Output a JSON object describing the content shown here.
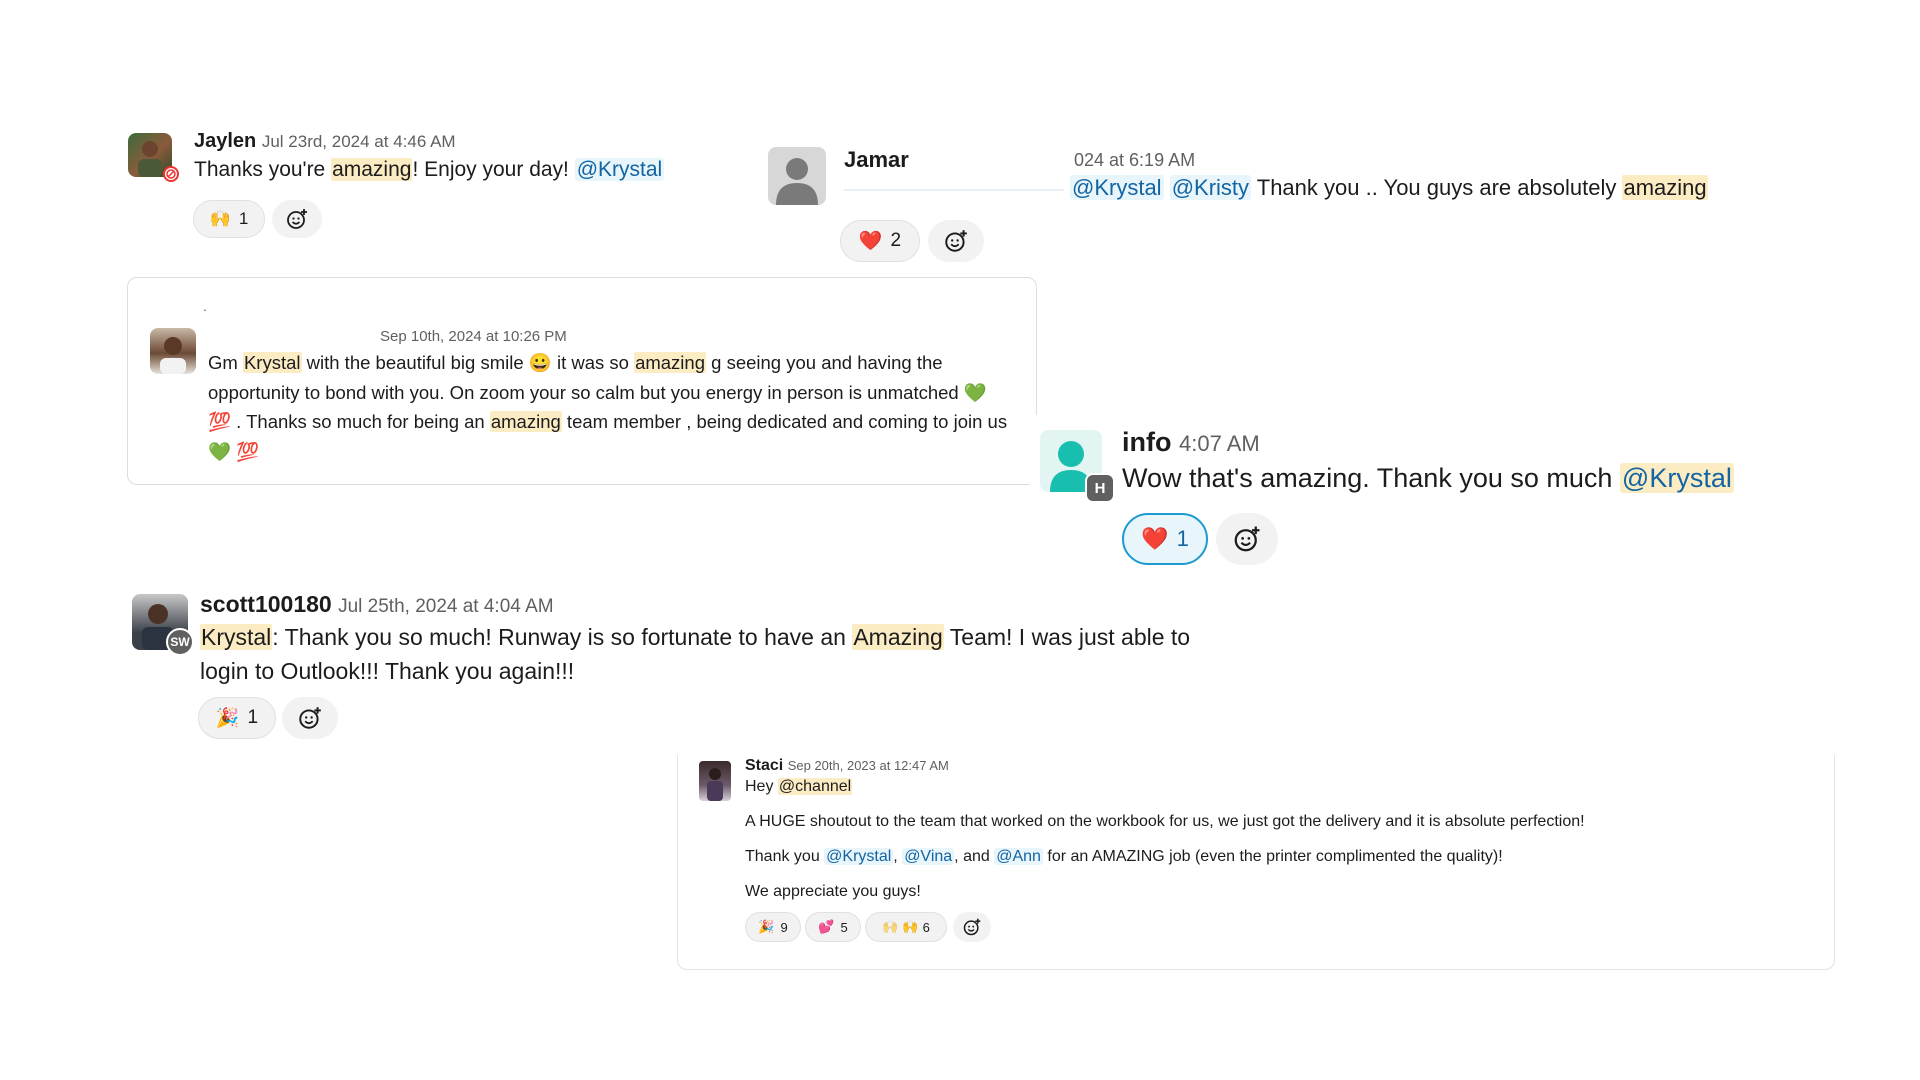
{
  "jaylen": {
    "name": "Jaylen",
    "time": "Jul 23rd, 2024 at 4:46 AM",
    "text_a": "Thanks you're ",
    "hl": "amazing",
    "text_b": "! Enjoy your day! ",
    "mention": "@Krystal",
    "reaction_count": "1"
  },
  "jamar": {
    "name": "Jamar",
    "time": "024 at 6:19 AM",
    "mention1": "@Krystal",
    "mention2": "@Kristy",
    "text": " Thank you .. You guys are absolutely ",
    "hl": "amazing",
    "reaction_count": "2"
  },
  "quote": {
    "dot": ".",
    "time": "Sep 10th, 2024 at 10:26 PM",
    "t1": "Gm ",
    "hl1": "Krystal",
    "t2": " with the beautiful big smile ",
    "t3": " it was so ",
    "hl2": "amazing",
    "t4": " g seeing you and having the opportunity to bond with you. On zoom your so calm but you energy in person is unmatched ",
    "t5": " . Thanks so much for being an ",
    "hl3": "amazing",
    "t6": " team member , being dedicated and coming to join us "
  },
  "info": {
    "name": "info",
    "time": "4:07 AM",
    "badge": "H",
    "text": "Wow that's amazing. Thank you so much ",
    "mention": "@Krystal",
    "reaction_count": "1"
  },
  "scott": {
    "name": "scott100180",
    "time": "Jul 25th, 2024 at 4:04 AM",
    "badge": "SW",
    "hl1": "Krystal",
    "t1": ": Thank you so much!  Runway is so fortunate to have an ",
    "hl2": "Amazing",
    "t2": " Team!  I was just able to login to Outlook!!! Thank you again!!!",
    "reaction_count": "1"
  },
  "staci": {
    "name": "Staci",
    "time": "Sep 20th, 2023 at 12:47 AM",
    "hey": "Hey ",
    "channel": "@channel",
    "line2": "A HUGE shoutout to the team that worked on the workbook for us, we just got the delivery and it is absolute perfection!",
    "line3a": "Thank you ",
    "m1": "@Krystal",
    "sep1": ", ",
    "m2": "@Vina",
    "sep2": ", and ",
    "m3": "@Ann",
    "line3b": " for an AMAZING job (even the printer complimented the quality)!",
    "line4": "We appreciate you guys!",
    "r1": "9",
    "r2": "5",
    "r3": "6"
  },
  "colors": {
    "highlight": "#fcecc4",
    "mention": "#1264a3",
    "mention_bg": "#e8f5fa",
    "active_reaction_border": "#1d9bd1"
  },
  "icons": [
    "raised-hands",
    "red-heart",
    "party-popper",
    "sparkling-heart",
    "green-heart",
    "hundred-points",
    "grinning-face",
    "add-reaction"
  ]
}
